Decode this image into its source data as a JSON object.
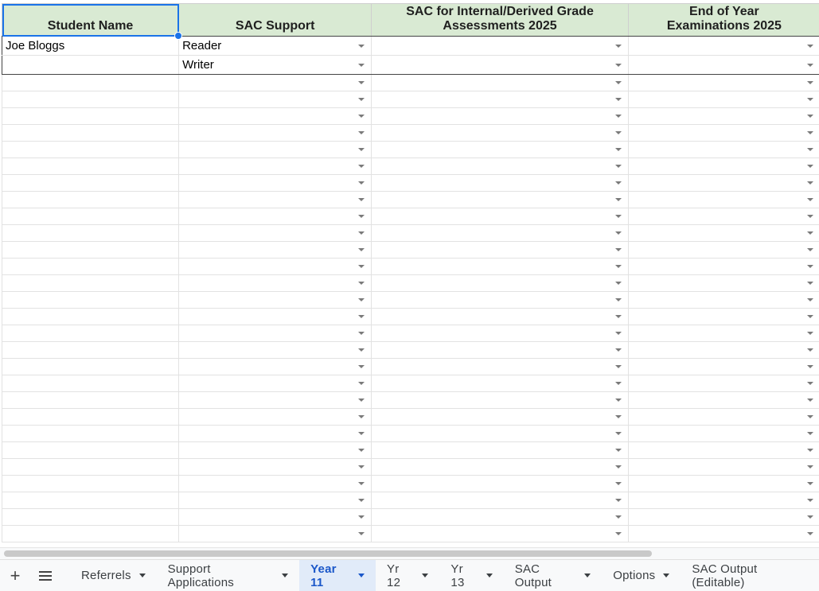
{
  "sheet": {
    "headers": [
      "Student Name",
      "SAC Support",
      "SAC for Internal/Derived Grade\nAssessments 2025",
      "End of Year\nExaminations 2025"
    ],
    "rows": [
      [
        "Joe Bloggs",
        "Reader",
        "",
        ""
      ],
      [
        "",
        "Writer",
        "",
        ""
      ]
    ],
    "empty_row_count": 28,
    "header_fill": "#d9ead3",
    "selection_color": "#1a73e8"
  },
  "tabbar": {
    "add_icon": "plus-icon",
    "menu_icon": "hamburger-icon",
    "tabs": [
      {
        "label": "Referrels",
        "active": false
      },
      {
        "label": "Support Applications",
        "active": false
      },
      {
        "label": "Year 11",
        "active": true
      },
      {
        "label": "Yr 12",
        "active": false
      },
      {
        "label": "Yr 13",
        "active": false
      },
      {
        "label": "SAC Output",
        "active": false
      },
      {
        "label": "Options",
        "active": false
      },
      {
        "label": "SAC Output (Editable)",
        "active": false
      }
    ],
    "active_color": "#1a57c9",
    "active_bg": "#e1ebf9"
  }
}
